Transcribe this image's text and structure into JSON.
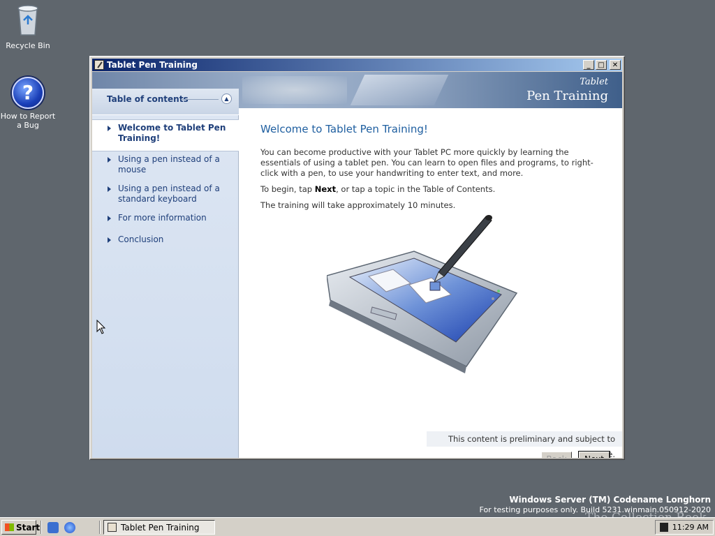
{
  "desktop": {
    "icons": [
      {
        "label": "Recycle Bin"
      },
      {
        "label": "How to Report a Bug"
      }
    ],
    "watermark": {
      "line1": "Windows Server (TM) Codename Longhorn",
      "line2": "For testing purposes only. Build 5231.winmain.050912-2020"
    },
    "overlay_text": "The Collection Book"
  },
  "window": {
    "title": "Tablet Pen Training",
    "brand": {
      "line1": "Tablet",
      "line2": "Pen Training"
    },
    "toc": {
      "title": "Table of contents",
      "items": [
        {
          "label": "Welcome to Tablet Pen Training!",
          "active": true
        },
        {
          "label": "Using a pen instead of a mouse"
        },
        {
          "label": "Using a pen instead of a standard keyboard"
        },
        {
          "label": "For more information"
        },
        {
          "label": "Conclusion"
        }
      ]
    },
    "content": {
      "heading": "Welcome to Tablet Pen Training!",
      "paragraph1": "You can become productive with your Tablet PC more quickly by learning the essentials of using a tablet pen. You can learn to open files and programs, to right-click with a pen, to use your handwriting to enter text, and more.",
      "paragraph2_pre": "To begin, tap ",
      "paragraph2_bold": "Next",
      "paragraph2_post": ", or tap a topic in the Table of Contents.",
      "paragraph3": "The training will take approximately 10 minutes.",
      "notice": "This content is preliminary and subject to change."
    },
    "buttons": {
      "back": "Back",
      "next": "Next"
    }
  },
  "taskbar": {
    "start_label": "Start",
    "task_label": "Tablet Pen Training",
    "clock": "11:29 AM"
  }
}
